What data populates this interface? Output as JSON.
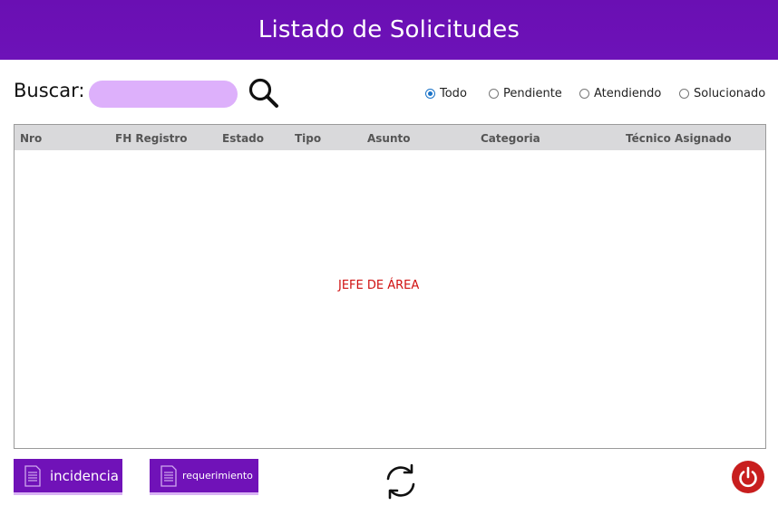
{
  "header": {
    "title": "Listado de Solicitudes"
  },
  "search": {
    "label": "Buscar:",
    "value": "",
    "placeholder": ""
  },
  "filters": [
    {
      "label": "Todo",
      "checked": true
    },
    {
      "label": "Pendiente",
      "checked": false
    },
    {
      "label": "Atendiendo",
      "checked": false
    },
    {
      "label": "Solucionado",
      "checked": false
    }
  ],
  "table": {
    "columns": [
      "Nro",
      "FH Registro",
      "Estado",
      "Tipo",
      "Asunto",
      "Categoria",
      "Técnico Asignado"
    ],
    "rows": [],
    "empty_message": "JEFE DE ÁREA"
  },
  "actions": {
    "incidencia_label": "incidencia",
    "requerimiento_label": "requerimiento"
  },
  "colors": {
    "header_bg": "#6a0fb3",
    "accent": "#7012b8",
    "search_bg": "#ddb0fb",
    "power": "#c81e1e"
  },
  "icons": {
    "search": "search-icon",
    "document": "document-icon",
    "refresh": "refresh-icon",
    "power": "power-icon"
  }
}
